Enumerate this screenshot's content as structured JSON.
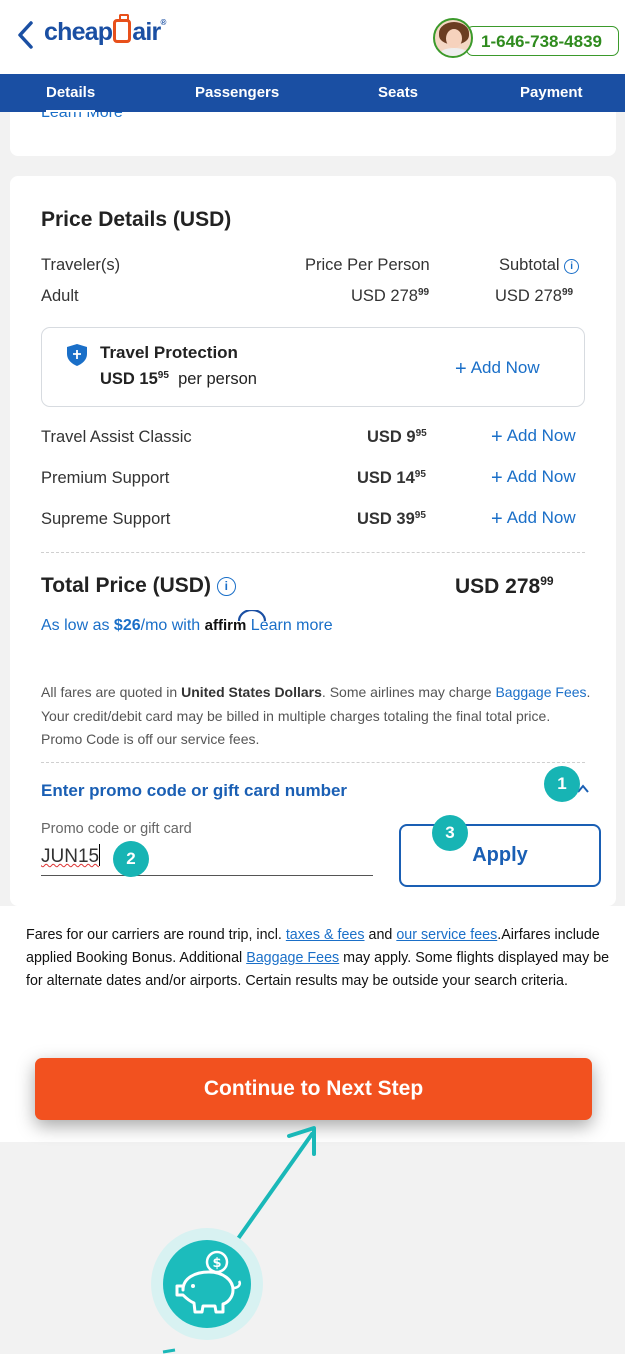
{
  "header": {
    "logo_text": "cheapOair",
    "phone": "1-646-738-4839"
  },
  "nav": {
    "tabs": [
      {
        "label": "Details",
        "active": true
      },
      {
        "label": "Passengers"
      },
      {
        "label": "Seats"
      },
      {
        "label": "Payment"
      }
    ]
  },
  "top_card": {
    "learn_more": "Learn More"
  },
  "price": {
    "title": "Price Details (USD)",
    "col_traveler": "Traveler(s)",
    "col_ppp": "Price Per Person",
    "col_subtotal": "Subtotal",
    "row_label": "Adult",
    "row_ppp_main": "USD 278",
    "row_ppp_cents": "99",
    "row_sub_main": "USD 278",
    "row_sub_cents": "99"
  },
  "protection": {
    "title": "Travel Protection",
    "price_main": "USD 15",
    "price_cents": "95",
    "per": "per person",
    "add": "Add Now"
  },
  "addons": [
    {
      "label": "Travel Assist Classic",
      "price_main": "USD 9",
      "price_cents": "95",
      "add": "Add Now"
    },
    {
      "label": "Premium Support",
      "price_main": "USD 14",
      "price_cents": "95",
      "add": "Add Now"
    },
    {
      "label": "Supreme Support",
      "price_main": "USD 39",
      "price_cents": "95",
      "add": "Add Now"
    }
  ],
  "total": {
    "label": "Total Price (USD)",
    "amount_main": "USD 278",
    "amount_cents": "99"
  },
  "affirm": {
    "prefix": "As low as ",
    "amount": "$26",
    "suffix": "/mo with",
    "brand": "affirm",
    "learn_more": "Learn more"
  },
  "disclaimer": {
    "p1": "All fares are quoted in ",
    "bold": "United States Dollars",
    "p2": ". Some airlines may charge ",
    "link": "Baggage Fees",
    "p3": ". Your credit/debit card may be billed in multiple charges totaling the final total price. Promo Code is off our service fees."
  },
  "promo": {
    "heading": "Enter promo code or gift card number",
    "label": "Promo code or gift card",
    "value": "JUN15",
    "apply": "Apply"
  },
  "badges": [
    "1",
    "2",
    "3"
  ],
  "fares_note": {
    "a": "Fares for our carriers are round trip, incl. ",
    "link1": "taxes & fees",
    "b": " and ",
    "link2": "our service fees",
    "c": ".Airfares include applied Booking Bonus. Additional ",
    "link3": "Baggage Fees",
    "d": " may apply. Some flights displayed may be for alternate dates and/or airports. Certain results may be outside your search criteria."
  },
  "continue_label": "Continue to Next Step",
  "colors": {
    "brand_blue": "#1a4fa3",
    "accent_orange": "#f2511f",
    "teal": "#17b4b4",
    "phone_green": "#2f8b1e"
  }
}
